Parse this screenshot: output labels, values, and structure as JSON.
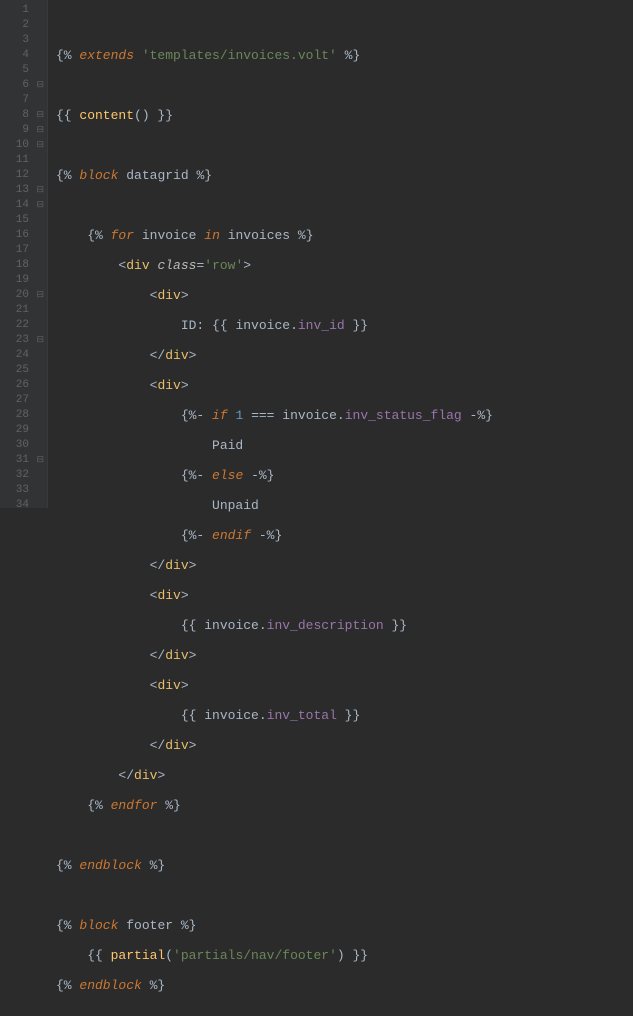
{
  "lines": {
    "l1": "1",
    "l2": "2",
    "l3": "3",
    "l4": "4",
    "l5": "5",
    "l6": "6",
    "l7": "7",
    "l8": "8",
    "l9": "9",
    "l10": "10",
    "l11": "11",
    "l12": "12",
    "l13": "13",
    "l14": "14",
    "l15": "15",
    "l16": "16",
    "l17": "17",
    "l18": "18",
    "l19": "19",
    "l20": "20",
    "l21": "21",
    "l22": "22",
    "l23": "23",
    "l24": "24",
    "l25": "25",
    "l26": "26",
    "l27": "27",
    "l28": "28",
    "l29": "29",
    "l30": "30",
    "l31": "31",
    "l32": "32",
    "l33": "33",
    "l34": "34"
  },
  "t": {
    "open_stmt": "{% ",
    "close_stmt": " %}",
    "open_out": "{{ ",
    "close_out": " }}",
    "open_trim": "{%- ",
    "close_trim": " -%}",
    "extends": "extends",
    "tpl_path": "'templates/invoices.volt'",
    "content": "content",
    "parens": "()",
    "block": "block",
    "datagrid": "datagrid",
    "for": "for",
    "invoice": "invoice",
    "in": "in",
    "invoices": "invoices",
    "lt": "<",
    "gt": ">",
    "lts": "</",
    "div": "div",
    "class": "class",
    "eq": "=",
    "row": "'row'",
    "id_label": "ID: ",
    "dot": ".",
    "inv_id": "inv_id",
    "if": "if",
    "one": "1",
    "triple_eq": " === ",
    "inv_status_flag": "inv_status_flag",
    "paid": "Paid",
    "else": "else",
    "unpaid": "Unpaid",
    "endif": "endif",
    "inv_description": "inv_description",
    "inv_total": "inv_total",
    "endfor": "endfor",
    "endblock": "endblock",
    "footer": "footer",
    "partial": "partial",
    "partial_path": "'partials/nav/footer'",
    "lparen": "(",
    "rparen": ")"
  }
}
